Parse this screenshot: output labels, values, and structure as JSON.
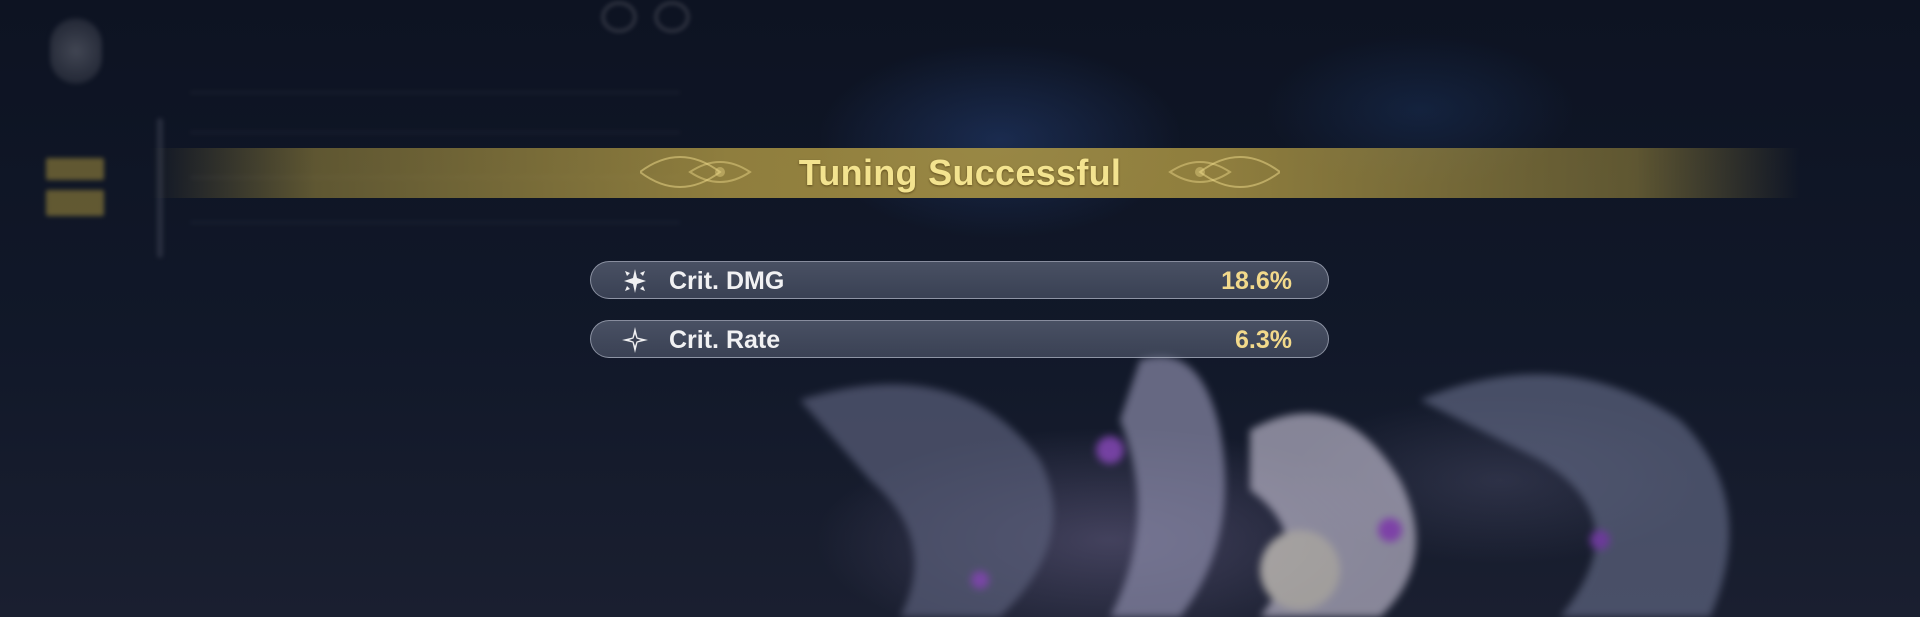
{
  "banner": {
    "title": "Tuning Successful",
    "accent_color": "#f3e38f"
  },
  "stats": [
    {
      "icon": "crit-dmg-icon",
      "label": "Crit. DMG",
      "value": "18.6%"
    },
    {
      "icon": "crit-rate-icon",
      "label": "Crit. Rate",
      "value": "6.3%"
    }
  ],
  "colors": {
    "value_gold": "#f2d98b",
    "banner_gold": "#af9844",
    "pill_bg": "#6c748a",
    "background": "#0c1120"
  }
}
